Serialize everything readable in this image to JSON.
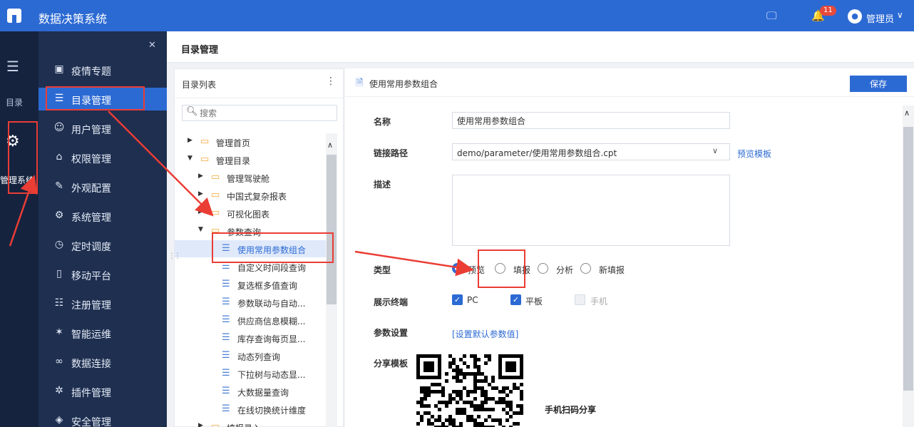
{
  "app": {
    "title": "数据决策系统",
    "notification_count": "11",
    "user": "管理员"
  },
  "rail": {
    "label_dir": "目录",
    "label_manage": "管理系统"
  },
  "nav": {
    "items": [
      {
        "label": "疫情专题",
        "icon": "chart-icon"
      },
      {
        "label": "目录管理",
        "icon": "list-icon",
        "active": true
      },
      {
        "label": "用户管理",
        "icon": "user-icon"
      },
      {
        "label": "权限管理",
        "icon": "lock-icon"
      },
      {
        "label": "外观配置",
        "icon": "brush-icon"
      },
      {
        "label": "系统管理",
        "icon": "settings-icon"
      },
      {
        "label": "定时调度",
        "icon": "clock-icon"
      },
      {
        "label": "移动平台",
        "icon": "mobile-icon"
      },
      {
        "label": "注册管理",
        "icon": "register-icon"
      },
      {
        "label": "智能运维",
        "icon": "ops-icon"
      },
      {
        "label": "数据连接",
        "icon": "link-icon"
      },
      {
        "label": "插件管理",
        "icon": "plugin-icon"
      },
      {
        "label": "安全管理",
        "icon": "shield-icon"
      }
    ]
  },
  "breadcrumb": "目录管理",
  "dir": {
    "title": "目录列表",
    "search_placeholder": "搜索",
    "tree": [
      {
        "label": "管理首页",
        "type": "folder",
        "level": 0,
        "state": "collapsed"
      },
      {
        "label": "管理目录",
        "type": "folder",
        "level": 0,
        "state": "expanded"
      },
      {
        "label": "管理驾驶舱",
        "type": "folder",
        "level": 1,
        "state": "collapsed"
      },
      {
        "label": "中国式复杂报表",
        "type": "folder",
        "level": 1,
        "state": "collapsed"
      },
      {
        "label": "可视化图表",
        "type": "folder",
        "level": 1,
        "state": "collapsed"
      },
      {
        "label": "参数查询",
        "type": "folder",
        "level": 1,
        "state": "expanded"
      },
      {
        "label": "使用常用参数组合",
        "type": "file",
        "level": 2,
        "selected": true
      },
      {
        "label": "自定义时间段查询",
        "type": "file",
        "level": 2
      },
      {
        "label": "复选框多值查询",
        "type": "file",
        "level": 2
      },
      {
        "label": "参数联动与自动...",
        "type": "file",
        "level": 2
      },
      {
        "label": "供应商信息模糊...",
        "type": "file",
        "level": 2
      },
      {
        "label": "库存查询每页显...",
        "type": "file",
        "level": 2
      },
      {
        "label": "动态列查询",
        "type": "file",
        "level": 2
      },
      {
        "label": "下拉树与动态显...",
        "type": "file",
        "level": 2
      },
      {
        "label": "大数据量查询",
        "type": "file",
        "level": 2
      },
      {
        "label": "在线切换统计维度",
        "type": "file",
        "level": 2
      },
      {
        "label": "填报录入",
        "type": "folder",
        "level": 1,
        "state": "collapsed"
      }
    ]
  },
  "edit": {
    "title": "使用常用参数组合",
    "save_label": "保存",
    "name_label": "名称",
    "name_value": "使用常用参数组合",
    "path_label": "链接路径",
    "path_value": "demo/parameter/使用常用参数组合.cpt",
    "preview_link": "预览模板",
    "desc_label": "描述",
    "desc_value": "",
    "type_label": "类型",
    "type_options": [
      "预览",
      "填报",
      "分析",
      "新填报"
    ],
    "type_selected": "预览",
    "terminal_label": "展示终端",
    "terminals": [
      {
        "label": "PC",
        "checked": true
      },
      {
        "label": "平板",
        "checked": true
      },
      {
        "label": "手机",
        "checked": false,
        "disabled": true
      }
    ],
    "param_label": "参数设置",
    "param_link": "[设置默认参数值]",
    "share_label": "分享模板",
    "share_note": "手机扫码分享"
  },
  "colors": {
    "topbar": "#2c6ad3",
    "rail": "#15233f",
    "nav": "#1e2f50",
    "accent": "#2c6ad3",
    "annotation": "#ea3d34"
  }
}
